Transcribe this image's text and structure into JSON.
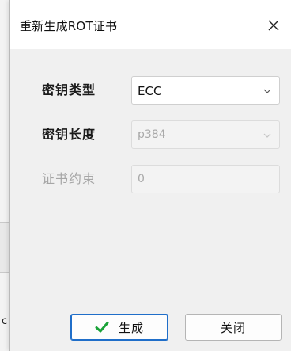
{
  "dialog": {
    "title": "重新生成ROT证书",
    "close_symbol": "✕"
  },
  "form": {
    "key_type": {
      "label": "密钥类型",
      "value": "ECC",
      "enabled": true
    },
    "key_length": {
      "label": "密钥长度",
      "value": "p384",
      "enabled": false
    },
    "cert_constraint": {
      "label": "证书约束",
      "value": "0",
      "enabled": false
    }
  },
  "buttons": {
    "generate": {
      "label": "生成",
      "icon": "checkmark-icon",
      "icon_color": "#1aa238"
    },
    "close": {
      "label": "关闭"
    }
  },
  "background": {
    "partial_text": "c"
  },
  "colors": {
    "accent": "#1f6ec9",
    "check_green": "#1aa238"
  }
}
